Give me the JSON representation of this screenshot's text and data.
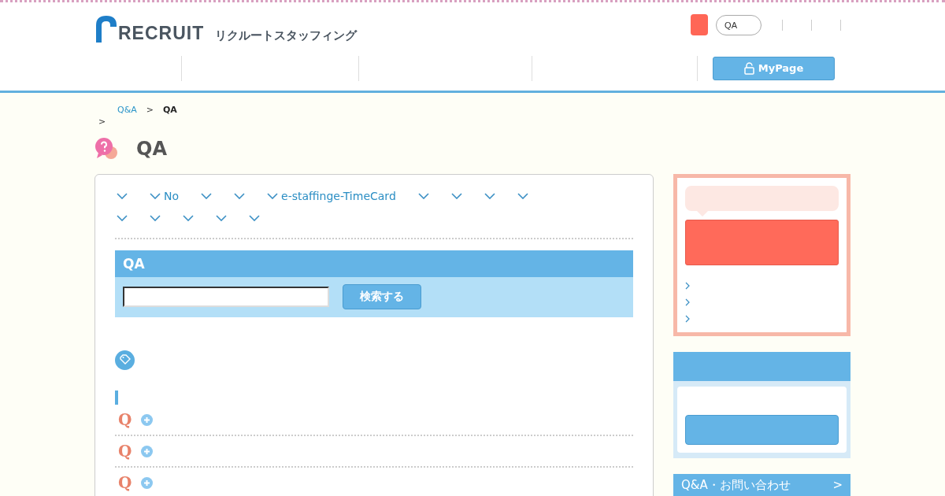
{
  "header": {
    "logo": {
      "wordmark": "RECRUIT",
      "company": "リクルートスタッフィング"
    },
    "search_pill": "QA",
    "mypage_button": "MyPage"
  },
  "breadcrumb": {
    "link": "Q&A",
    "separator": ">",
    "current": "QA",
    "second_separator": ">"
  },
  "page_title": "QA",
  "categories": [
    [
      {
        "kind": "link"
      },
      {
        "kind": "link",
        "label": "No"
      },
      {
        "kind": "link"
      },
      {
        "kind": "link"
      },
      {
        "kind": "link",
        "label": "e-staffinge-TimeCard"
      },
      {
        "kind": "link"
      },
      {
        "kind": "link"
      },
      {
        "kind": "link"
      },
      {
        "kind": "link"
      }
    ],
    [
      {
        "kind": "link"
      },
      {
        "kind": "link"
      },
      {
        "kind": "link"
      },
      {
        "kind": "link"
      },
      {
        "kind": "link"
      }
    ]
  ],
  "search": {
    "title": "QA",
    "button": "検索する"
  },
  "questions": [
    {
      "mark": "Q",
      "expanded": false
    },
    {
      "mark": "Q",
      "expanded": false
    },
    {
      "mark": "Q",
      "expanded": false
    }
  ],
  "sidebar": {
    "links": [
      {
        "kind": "link"
      },
      {
        "kind": "link"
      },
      {
        "kind": "link"
      }
    ],
    "contact_bar": "Q&A・お問い合わせ",
    "contact_arrow": ">"
  }
}
